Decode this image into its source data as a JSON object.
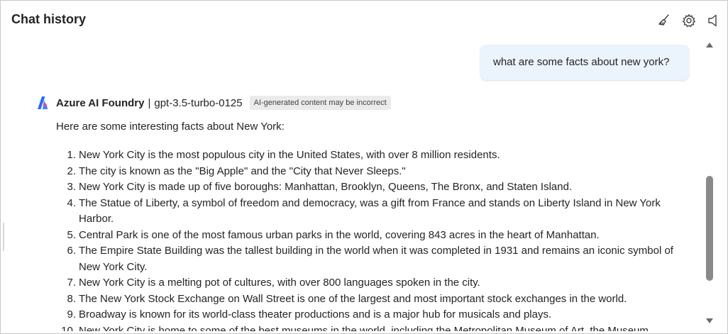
{
  "header": {
    "title": "Chat history",
    "icons": [
      "broom-icon",
      "gear-icon",
      "speaker-icon"
    ]
  },
  "user_message": "what are some facts about new york?",
  "assistant": {
    "name": "Azure AI Foundry",
    "separator": "|",
    "model": "gpt-3.5-turbo-0125",
    "badge": "AI-generated content may be incorrect",
    "intro": "Here are some interesting facts about New York:",
    "facts": [
      {
        "num": "1.",
        "text": "New York City is the most populous city in the United States, with over 8 million residents."
      },
      {
        "num": "2.",
        "text": "The city is known as the \"Big Apple\" and the \"City that Never Sleeps.\""
      },
      {
        "num": "3.",
        "text": "New York City is made up of five boroughs: Manhattan, Brooklyn, Queens, The Bronx, and Staten Island."
      },
      {
        "num": "4.",
        "text": "The Statue of Liberty, a symbol of freedom and democracy, was a gift from France and stands on Liberty Island in New York Harbor."
      },
      {
        "num": "5.",
        "text": "Central Park is one of the most famous urban parks in the world, covering 843 acres in the heart of Manhattan."
      },
      {
        "num": "6.",
        "text": "The Empire State Building was the tallest building in the world when it was completed in 1931 and remains an iconic symbol of New York City."
      },
      {
        "num": "7.",
        "text": "New York City is a melting pot of cultures, with over 800 languages spoken in the city."
      },
      {
        "num": "8.",
        "text": "The New York Stock Exchange on Wall Street is one of the largest and most important stock exchanges in the world."
      },
      {
        "num": "9.",
        "text": "Broadway is known for its world-class theater productions and is a major hub for musicals and plays."
      },
      {
        "num": "10.",
        "text": "New York City is home to some of the best museums in the world, including the Metropolitan Museum of Art, the Museum"
      }
    ]
  },
  "colors": {
    "user_bubble": "#ebf3fc",
    "badge_bg": "#ebebeb",
    "scroll_thumb": "#8a8a8a",
    "logo_blue": "#2f6bf2",
    "logo_pink": "#e64a8c"
  }
}
